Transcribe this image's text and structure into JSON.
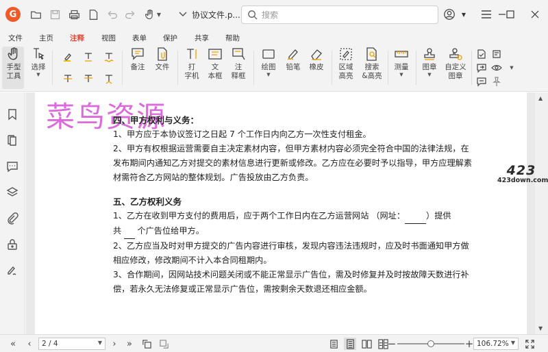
{
  "titlebar": {
    "app_logo": "G",
    "doc_tab_label": "协议文件.p...",
    "search_placeholder": "搜索"
  },
  "menu": {
    "tabs": [
      "文件",
      "主页",
      "注释",
      "视图",
      "表单",
      "保护",
      "共享",
      "帮助"
    ],
    "active": "注释"
  },
  "ribbon": {
    "hand": "手型\n工具",
    "select": "选择",
    "note": "备注",
    "file": "文件",
    "typewriter": "打\n字机",
    "textbox": "文\n本框",
    "callout": "注\n释框",
    "drawing": "绘图",
    "pencil": "铅笔",
    "eraser": "橡皮",
    "area_highlight": "区域\n高亮",
    "search_highlight": "搜索\n&高亮",
    "measure": "测量",
    "stamp": "图章",
    "custom_stamp": "自定义\n图章"
  },
  "watermark": "菜鸟资源",
  "site_logo": {
    "big": "423",
    "small": "423down.com"
  },
  "document": {
    "sec4_title": "四、甲方权利与义务：",
    "sec4_p1": "1、甲方应于本协议签订之日起 7 个工作日内向乙方一次性支付租金。",
    "sec4_p2": "2、甲方有权根据运营需要自主决定素材内容，但甲方素材内容必须完全符合中国的法律法规，在发布期间内通知乙方对提交的素材信息进行更新或修改。乙方应在必要时予以指导，甲方应理解素材需符合乙方网站的整体规划。广告投放由乙方负责。",
    "sec5_title": "五、乙方权利义务",
    "sec5_p1_a": "1、乙方在收到甲方支付的费用后，应于两个工作日内在乙方运营网站 （网址：",
    "sec5_p1_blank1": "        ",
    "sec5_p1_b": "）提供",
    "sec5_p1_c": "共",
    "sec5_p1_blank2": "    ",
    "sec5_p1_d": "个广告位给甲方。",
    "sec5_p2": "2、乙方应当及时对甲方提交的广告内容进行审核，发现内容违法违规时，应及时书面通知甲方做相应修改，修改期间不计入本合同租期内。",
    "sec5_p3": "3、合作期间，因网站技术问题关闭或不能正常显示广告位，需及时修复并及时按故障天数进行补偿，若永久无法修复或正常显示广告位，需按剩余天数退还相应金额。"
  },
  "status": {
    "page": "2 / 4",
    "zoom": "106.72%",
    "zoom_fraction": 0.5
  },
  "colors": {
    "accent": "#e8452c",
    "logo": "#ef5a2a",
    "watermark": "#d85ad8"
  }
}
